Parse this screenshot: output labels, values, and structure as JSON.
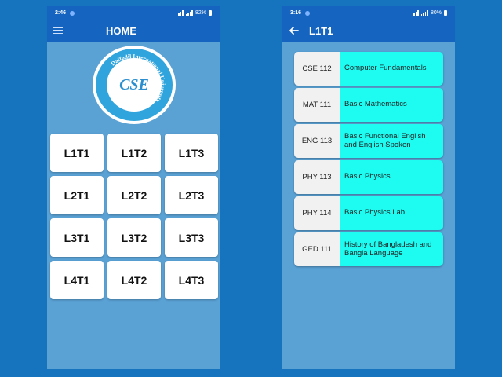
{
  "home": {
    "status": {
      "time": "2:46",
      "battery": "82%"
    },
    "title": "HOME",
    "logo": {
      "text": "CSE",
      "university": "Daffodil International University"
    },
    "terms": [
      "L1T1",
      "L1T2",
      "L1T3",
      "L2T1",
      "L2T2",
      "L2T3",
      "L3T1",
      "L3T2",
      "L3T3",
      "L4T1",
      "L4T2",
      "L4T3"
    ]
  },
  "course_screen": {
    "status": {
      "time": "3:16",
      "battery": "80%"
    },
    "title": "L1T1",
    "courses": [
      {
        "code": "CSE 112",
        "name": "Computer Fundamentals"
      },
      {
        "code": "MAT 111",
        "name": "Basic Mathematics"
      },
      {
        "code": "ENG 113",
        "name": "Basic Functional English and English Spoken"
      },
      {
        "code": "PHY 113",
        "name": "Basic Physics"
      },
      {
        "code": "PHY 114",
        "name": "Basic Physics Lab"
      },
      {
        "code": "GED 111",
        "name": "History of Bangladesh and Bangla Language"
      }
    ]
  },
  "colors": {
    "background": "#1574bd",
    "app_bar": "#1565c0",
    "screen": "#5aa1d4",
    "course_name_bg": "#1efcf2"
  }
}
